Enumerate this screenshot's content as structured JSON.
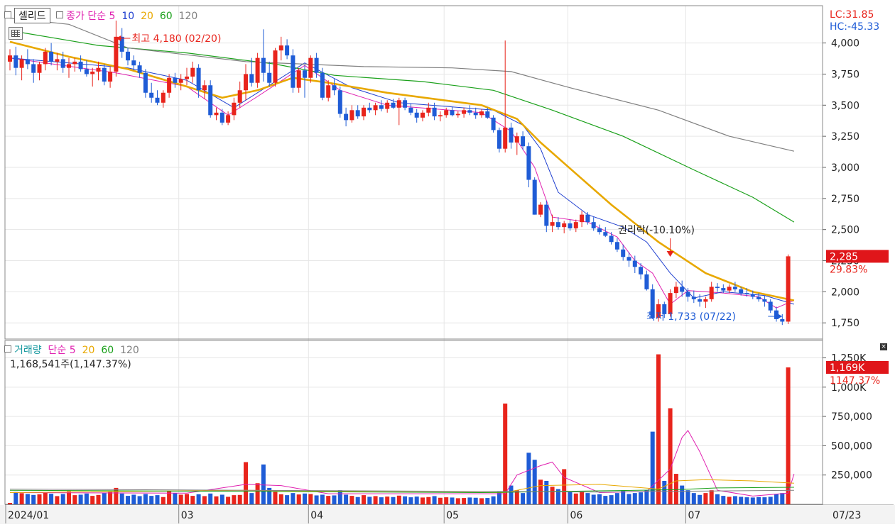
{
  "top_legend": {
    "stock": "셀리드",
    "price_type": "종가",
    "ma_label": "단순",
    "ma_periods": [
      "5",
      "10",
      "20",
      "60",
      "120"
    ]
  },
  "vol_legend": {
    "title": "거래량",
    "ma_label": "단순",
    "ma_periods": [
      "5",
      "20",
      "60",
      "120"
    ],
    "current": "1,168,541주(1,147.37%)"
  },
  "price_axis": {
    "ticks": [
      "4,000",
      "3,750",
      "3,500",
      "3,250",
      "3,000",
      "2,750",
      "2,500",
      "2,250",
      "2,000",
      "1,750"
    ],
    "lc": "LC:31.85",
    "hc": "HC:-45.33",
    "last_price": "2,285",
    "last_change": "29.83%"
  },
  "vol_axis": {
    "ticks": [
      "1,250K",
      "1,000K",
      "750,000",
      "500,000",
      "250,000"
    ],
    "last_vol": "1,169K",
    "last_change": "1147.37%"
  },
  "x_axis": {
    "labels": [
      "2024/01",
      "03",
      "04",
      "05",
      "06",
      "07"
    ],
    "current_date": "07/23"
  },
  "annotations": {
    "high": "최고 4,180 (02/20)",
    "low": "최저 1,733 (07/22)",
    "rights": "권리락(-10.10%)"
  },
  "colors": {
    "up": "#e8241c",
    "down": "#1f5cd6",
    "ma5": "#e020b0",
    "ma10": "#1f3fd0",
    "ma20": "#e8a800",
    "ma60": "#1aa01a",
    "ma120": "#808080"
  },
  "chart_data": {
    "type": "candlestick",
    "price_range": [
      1620,
      4300
    ],
    "candles": [
      [
        3850,
        3950,
        3780,
        3900,
        12000
      ],
      [
        3900,
        3970,
        3740,
        3800,
        105000
      ],
      [
        3800,
        3900,
        3700,
        3870,
        95000
      ],
      [
        3870,
        3950,
        3790,
        3830,
        88000
      ],
      [
        3830,
        3870,
        3680,
        3760,
        80000
      ],
      [
        3760,
        3850,
        3700,
        3830,
        85000
      ],
      [
        3830,
        3960,
        3780,
        3930,
        102000
      ],
      [
        3930,
        4000,
        3820,
        3850,
        90000
      ],
      [
        3850,
        3920,
        3780,
        3870,
        70000
      ],
      [
        3870,
        3930,
        3760,
        3800,
        88000
      ],
      [
        3800,
        3880,
        3720,
        3830,
        112000
      ],
      [
        3830,
        3880,
        3770,
        3850,
        78000
      ],
      [
        3850,
        3900,
        3770,
        3790,
        82000
      ],
      [
        3790,
        3860,
        3730,
        3750,
        92000
      ],
      [
        3750,
        3800,
        3650,
        3770,
        72000
      ],
      [
        3770,
        3850,
        3700,
        3800,
        80000
      ],
      [
        3800,
        3830,
        3660,
        3690,
        95000
      ],
      [
        3690,
        3810,
        3640,
        3770,
        105000
      ],
      [
        3770,
        4180,
        3730,
        4050,
        140000
      ],
      [
        4050,
        4120,
        3880,
        3930,
        92000
      ],
      [
        3930,
        3960,
        3820,
        3860,
        72000
      ],
      [
        3860,
        3900,
        3780,
        3820,
        82000
      ],
      [
        3820,
        3850,
        3720,
        3760,
        70000
      ],
      [
        3760,
        3790,
        3560,
        3600,
        88000
      ],
      [
        3600,
        3680,
        3520,
        3560,
        72000
      ],
      [
        3560,
        3620,
        3500,
        3520,
        78000
      ],
      [
        3520,
        3620,
        3480,
        3600,
        62000
      ],
      [
        3600,
        3750,
        3560,
        3720,
        112000
      ],
      [
        3720,
        3760,
        3640,
        3680,
        96000
      ],
      [
        3680,
        3750,
        3620,
        3710,
        82000
      ],
      [
        3710,
        3800,
        3660,
        3730,
        88000
      ],
      [
        3730,
        3850,
        3680,
        3800,
        72000
      ],
      [
        3800,
        3830,
        3560,
        3620,
        86000
      ],
      [
        3620,
        3700,
        3550,
        3660,
        70000
      ],
      [
        3660,
        3700,
        3400,
        3420,
        92000
      ],
      [
        3420,
        3480,
        3380,
        3440,
        68000
      ],
      [
        3440,
        3470,
        3340,
        3360,
        82000
      ],
      [
        3360,
        3450,
        3340,
        3420,
        64000
      ],
      [
        3420,
        3560,
        3380,
        3520,
        78000
      ],
      [
        3520,
        3690,
        3480,
        3620,
        80000
      ],
      [
        3620,
        3830,
        3540,
        3750,
        360000
      ],
      [
        3750,
        3880,
        3650,
        3680,
        96000
      ],
      [
        3680,
        3920,
        3640,
        3880,
        180000
      ],
      [
        3880,
        4110,
        3690,
        3760,
        340000
      ],
      [
        3760,
        3850,
        3650,
        3680,
        140000
      ],
      [
        3680,
        3960,
        3650,
        3940,
        110000
      ],
      [
        3940,
        4050,
        3860,
        3980,
        86000
      ],
      [
        3980,
        4030,
        3870,
        3900,
        78000
      ],
      [
        3900,
        3950,
        3600,
        3640,
        96000
      ],
      [
        3640,
        3800,
        3600,
        3780,
        84000
      ],
      [
        3780,
        3820,
        3560,
        3720,
        92000
      ],
      [
        3720,
        3900,
        3680,
        3880,
        88000
      ],
      [
        3880,
        3920,
        3720,
        3760,
        76000
      ],
      [
        3760,
        3800,
        3540,
        3560,
        82000
      ],
      [
        3560,
        3700,
        3530,
        3660,
        72000
      ],
      [
        3660,
        3710,
        3580,
        3620,
        76000
      ],
      [
        3620,
        3650,
        3400,
        3430,
        120000
      ],
      [
        3430,
        3480,
        3330,
        3380,
        82000
      ],
      [
        3380,
        3500,
        3360,
        3460,
        72000
      ],
      [
        3460,
        3500,
        3390,
        3410,
        62000
      ],
      [
        3410,
        3500,
        3380,
        3480,
        78000
      ],
      [
        3480,
        3520,
        3440,
        3460,
        64000
      ],
      [
        3460,
        3520,
        3420,
        3500,
        70000
      ],
      [
        3500,
        3540,
        3450,
        3470,
        60000
      ],
      [
        3470,
        3540,
        3440,
        3520,
        66000
      ],
      [
        3520,
        3550,
        3470,
        3480,
        62000
      ],
      [
        3480,
        3560,
        3340,
        3540,
        74000
      ],
      [
        3540,
        3560,
        3460,
        3480,
        68000
      ],
      [
        3480,
        3510,
        3420,
        3440,
        60000
      ],
      [
        3440,
        3470,
        3360,
        3400,
        66000
      ],
      [
        3400,
        3460,
        3370,
        3440,
        58000
      ],
      [
        3440,
        3520,
        3410,
        3480,
        62000
      ],
      [
        3480,
        3520,
        3380,
        3410,
        70000
      ],
      [
        3410,
        3450,
        3370,
        3420,
        56000
      ],
      [
        3420,
        3480,
        3400,
        3460,
        60000
      ],
      [
        3460,
        3490,
        3410,
        3420,
        58000
      ],
      [
        3420,
        3450,
        3400,
        3430,
        52000
      ],
      [
        3430,
        3480,
        3400,
        3460,
        54000
      ],
      [
        3460,
        3500,
        3420,
        3440,
        58000
      ],
      [
        3440,
        3480,
        3390,
        3420,
        56000
      ],
      [
        3420,
        3470,
        3400,
        3450,
        52000
      ],
      [
        3450,
        3480,
        3390,
        3400,
        54000
      ],
      [
        3400,
        3420,
        3280,
        3300,
        68000
      ],
      [
        3300,
        3320,
        3120,
        3150,
        110000
      ],
      [
        3150,
        4020,
        3120,
        3320,
        860000
      ],
      [
        3320,
        3360,
        3150,
        3200,
        160000
      ],
      [
        3200,
        3280,
        3100,
        3250,
        120000
      ],
      [
        3250,
        3290,
        3140,
        3170,
        96000
      ],
      [
        3170,
        3200,
        2840,
        2900,
        440000
      ],
      [
        2900,
        2920,
        2620,
        2620,
        380000
      ],
      [
        2620,
        2720,
        2600,
        2700,
        210000
      ],
      [
        2700,
        2730,
        2480,
        2530,
        200000
      ],
      [
        2530,
        2620,
        2480,
        2560,
        150000
      ],
      [
        2560,
        2600,
        2500,
        2520,
        130000
      ],
      [
        2520,
        2570,
        2470,
        2550,
        300000
      ],
      [
        2550,
        2580,
        2490,
        2510,
        110000
      ],
      [
        2510,
        2580,
        2480,
        2560,
        92000
      ],
      [
        2560,
        2650,
        2520,
        2620,
        110000
      ],
      [
        2620,
        2640,
        2540,
        2560,
        96000
      ],
      [
        2560,
        2600,
        2490,
        2510,
        82000
      ],
      [
        2510,
        2540,
        2460,
        2480,
        86000
      ],
      [
        2480,
        2520,
        2440,
        2450,
        72000
      ],
      [
        2450,
        2480,
        2380,
        2400,
        78000
      ],
      [
        2400,
        2430,
        2320,
        2340,
        96000
      ],
      [
        2340,
        2380,
        2250,
        2280,
        120000
      ],
      [
        2280,
        2320,
        2200,
        2250,
        88000
      ],
      [
        2250,
        2290,
        2150,
        2200,
        96000
      ],
      [
        2200,
        2230,
        2100,
        2140,
        102000
      ],
      [
        2140,
        2170,
        2010,
        2020,
        120000
      ],
      [
        2020,
        2060,
        1780,
        1790,
        620000
      ],
      [
        1790,
        1940,
        1760,
        1900,
        1280000
      ],
      [
        1900,
        1920,
        1790,
        1820,
        200000
      ],
      [
        1820,
        2020,
        1800,
        1990,
        820000
      ],
      [
        1990,
        2080,
        1950,
        2040,
        260000
      ],
      [
        2040,
        2090,
        1960,
        2000,
        160000
      ],
      [
        2000,
        2030,
        1920,
        1960,
        120000
      ],
      [
        1960,
        2010,
        1910,
        1940,
        96000
      ],
      [
        1940,
        1980,
        1880,
        1920,
        80000
      ],
      [
        1920,
        1960,
        1870,
        1940,
        96000
      ],
      [
        1940,
        2080,
        1920,
        2040,
        120000
      ],
      [
        2040,
        2070,
        2000,
        2030,
        86000
      ],
      [
        2030,
        2060,
        1990,
        2010,
        72000
      ],
      [
        2010,
        2060,
        1990,
        2040,
        64000
      ],
      [
        2040,
        2080,
        2000,
        2020,
        70000
      ],
      [
        2020,
        2040,
        1970,
        1990,
        64000
      ],
      [
        1990,
        2030,
        1960,
        1980,
        60000
      ],
      [
        1980,
        2010,
        1940,
        1960,
        58000
      ],
      [
        1960,
        1990,
        1920,
        1940,
        62000
      ],
      [
        1940,
        1970,
        1880,
        1920,
        60000
      ],
      [
        1920,
        1940,
        1830,
        1850,
        64000
      ],
      [
        1850,
        1880,
        1760,
        1780,
        88000
      ],
      [
        1780,
        1820,
        1733,
        1760,
        96000
      ],
      [
        1760,
        2300,
        1740,
        2285,
        1168541
      ]
    ],
    "ma": {
      "5": [
        [
          0,
          3880
        ],
        [
          18,
          3760
        ],
        [
          30,
          3650
        ],
        [
          37,
          3420
        ],
        [
          42,
          3570
        ],
        [
          50,
          3820
        ],
        [
          56,
          3620
        ],
        [
          64,
          3500
        ],
        [
          80,
          3440
        ],
        [
          85,
          3290
        ],
        [
          89,
          3000
        ],
        [
          92,
          2600
        ],
        [
          98,
          2560
        ],
        [
          103,
          2440
        ],
        [
          106,
          2250
        ],
        [
          109,
          2150
        ],
        [
          112,
          1900
        ],
        [
          115,
          2010
        ],
        [
          121,
          1990
        ],
        [
          127,
          1960
        ],
        [
          130,
          1870
        ],
        [
          133,
          1930
        ]
      ],
      "10": [
        [
          0,
          3880
        ],
        [
          20,
          3800
        ],
        [
          30,
          3700
        ],
        [
          38,
          3480
        ],
        [
          44,
          3660
        ],
        [
          50,
          3840
        ],
        [
          58,
          3640
        ],
        [
          66,
          3520
        ],
        [
          82,
          3460
        ],
        [
          87,
          3340
        ],
        [
          90,
          3150
        ],
        [
          93,
          2800
        ],
        [
          98,
          2620
        ],
        [
          104,
          2520
        ],
        [
          108,
          2400
        ],
        [
          112,
          2150
        ],
        [
          116,
          1950
        ],
        [
          121,
          2000
        ],
        [
          128,
          1970
        ],
        [
          133,
          1900
        ]
      ],
      "20": [
        [
          0,
          4010
        ],
        [
          10,
          3890
        ],
        [
          20,
          3790
        ],
        [
          30,
          3650
        ],
        [
          36,
          3560
        ],
        [
          42,
          3620
        ],
        [
          48,
          3720
        ],
        [
          54,
          3680
        ],
        [
          64,
          3600
        ],
        [
          80,
          3500
        ],
        [
          86,
          3390
        ],
        [
          90,
          3200
        ],
        [
          96,
          2950
        ],
        [
          102,
          2700
        ],
        [
          110,
          2400
        ],
        [
          118,
          2150
        ],
        [
          126,
          2000
        ],
        [
          133,
          1930
        ]
      ],
      "60": [
        [
          0,
          4100
        ],
        [
          15,
          3980
        ],
        [
          30,
          3920
        ],
        [
          45,
          3830
        ],
        [
          55,
          3740
        ],
        [
          70,
          3690
        ],
        [
          82,
          3620
        ],
        [
          92,
          3460
        ],
        [
          104,
          3250
        ],
        [
          116,
          2980
        ],
        [
          126,
          2760
        ],
        [
          133,
          2560
        ]
      ],
      "120": [
        [
          0,
          4200
        ],
        [
          10,
          4150
        ],
        [
          20,
          3960
        ],
        [
          40,
          3850
        ],
        [
          60,
          3810
        ],
        [
          75,
          3800
        ],
        [
          85,
          3770
        ],
        [
          95,
          3640
        ],
        [
          110,
          3460
        ],
        [
          122,
          3250
        ],
        [
          133,
          3130
        ]
      ]
    },
    "vol_ma": {
      "5": [
        [
          0,
          100000
        ],
        [
          30,
          95000
        ],
        [
          40,
          170000
        ],
        [
          46,
          160000
        ],
        [
          54,
          90000
        ],
        [
          84,
          90000
        ],
        [
          86,
          250000
        ],
        [
          90,
          330000
        ],
        [
          92,
          360000
        ],
        [
          94,
          230000
        ],
        [
          100,
          100000
        ],
        [
          108,
          110000
        ],
        [
          112,
          300000
        ],
        [
          114,
          570000
        ],
        [
          115,
          630000
        ],
        [
          117,
          450000
        ],
        [
          120,
          120000
        ],
        [
          126,
          70000
        ],
        [
          132,
          95000
        ],
        [
          133,
          260000
        ]
      ],
      "20": [
        [
          0,
          100000
        ],
        [
          40,
          120000
        ],
        [
          54,
          110000
        ],
        [
          84,
          100000
        ],
        [
          90,
          160000
        ],
        [
          100,
          170000
        ],
        [
          110,
          130000
        ],
        [
          113,
          200000
        ],
        [
          118,
          210000
        ],
        [
          126,
          200000
        ],
        [
          133,
          180000
        ]
      ],
      "60": [
        [
          0,
          120000
        ],
        [
          40,
          110000
        ],
        [
          80,
          100000
        ],
        [
          100,
          115000
        ],
        [
          113,
          125000
        ],
        [
          120,
          140000
        ],
        [
          133,
          145000
        ]
      ],
      "120": [
        [
          0,
          130000
        ],
        [
          60,
          115000
        ],
        [
          100,
          105000
        ],
        [
          133,
          120000
        ]
      ]
    },
    "vol_range": [
      0,
      1350000
    ]
  }
}
